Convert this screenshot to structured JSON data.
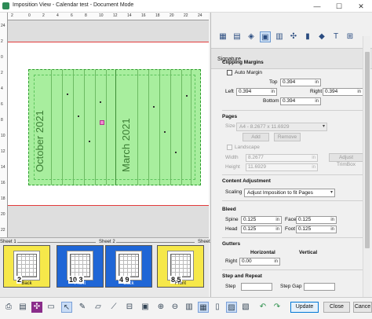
{
  "window": {
    "title": "Imposition View - Calendar test - Document Mode",
    "minimize": "—",
    "maximize": "☐",
    "close": "✕"
  },
  "rulers": {
    "top_ticks": [
      "2",
      "0",
      "2",
      "4",
      "6",
      "8",
      "10",
      "12",
      "14",
      "16",
      "18",
      "20",
      "22",
      "24"
    ],
    "left_ticks": [
      "24",
      "2",
      "0",
      "2",
      "4",
      "6",
      "8",
      "10",
      "12",
      "14",
      "16",
      "18",
      "20",
      "22"
    ]
  },
  "canvas": {
    "month_left": "October 2021",
    "month_right": "March 2021"
  },
  "pages_bar": {
    "sheet_labels": [
      "Sheet 1",
      "Sheet 2",
      "Sheet"
    ],
    "pages": [
      {
        "num": "2",
        "side": "Back",
        "color": "yellow"
      },
      {
        "num": "10 3",
        "side": "Front",
        "color": "blue"
      },
      {
        "num": "4 9",
        "side": "Back",
        "color": "blue"
      },
      {
        "num": "8 5",
        "side": "Front",
        "color": "yellow"
      }
    ]
  },
  "panel": {
    "header": "Signature",
    "clipping": {
      "title": "Clipping Margins",
      "auto_margin": "Auto Margin",
      "top_label": "Top",
      "top_value": "0.394",
      "left_label": "Left",
      "left_value": "0.394",
      "right_label": "Right",
      "right_value": "0.394",
      "bottom_label": "Bottom",
      "bottom_value": "0.394",
      "unit": "in"
    },
    "pages": {
      "title": "Pages",
      "size_label": "Size",
      "size_value": "A4 - 8.2677 x 11.6929",
      "add": "Add",
      "remove": "Remove",
      "landscape": "Landscape",
      "width_label": "Width",
      "width_value": "8.2677",
      "height_label": "Height",
      "height_value": "11.6929",
      "adjust_trimbox": "Adjust TrimBox",
      "unit": "in"
    },
    "content": {
      "title": "Content Adjustment",
      "scaling_label": "Scaling",
      "scaling_value": "Adjust Imposition to fit Pages"
    },
    "bleed": {
      "title": "Bleed",
      "spine_label": "Spine",
      "spine_value": "0.125",
      "face_label": "Face",
      "face_value": "0.125",
      "head_label": "Head",
      "head_value": "0.125",
      "foot_label": "Foot",
      "foot_value": "0.125",
      "unit": "in"
    },
    "gutters": {
      "title": "Gutters",
      "horizontal": "Horizontal",
      "vertical": "Vertical",
      "right_label": "Right",
      "right_value": "0.00",
      "unit": "in"
    },
    "step": {
      "title": "Step and Repeat",
      "step_label": "Step",
      "gap_label": "Step Gap"
    }
  },
  "footer": {
    "update": "Update",
    "close": "Close",
    "cancel": "Cance"
  }
}
